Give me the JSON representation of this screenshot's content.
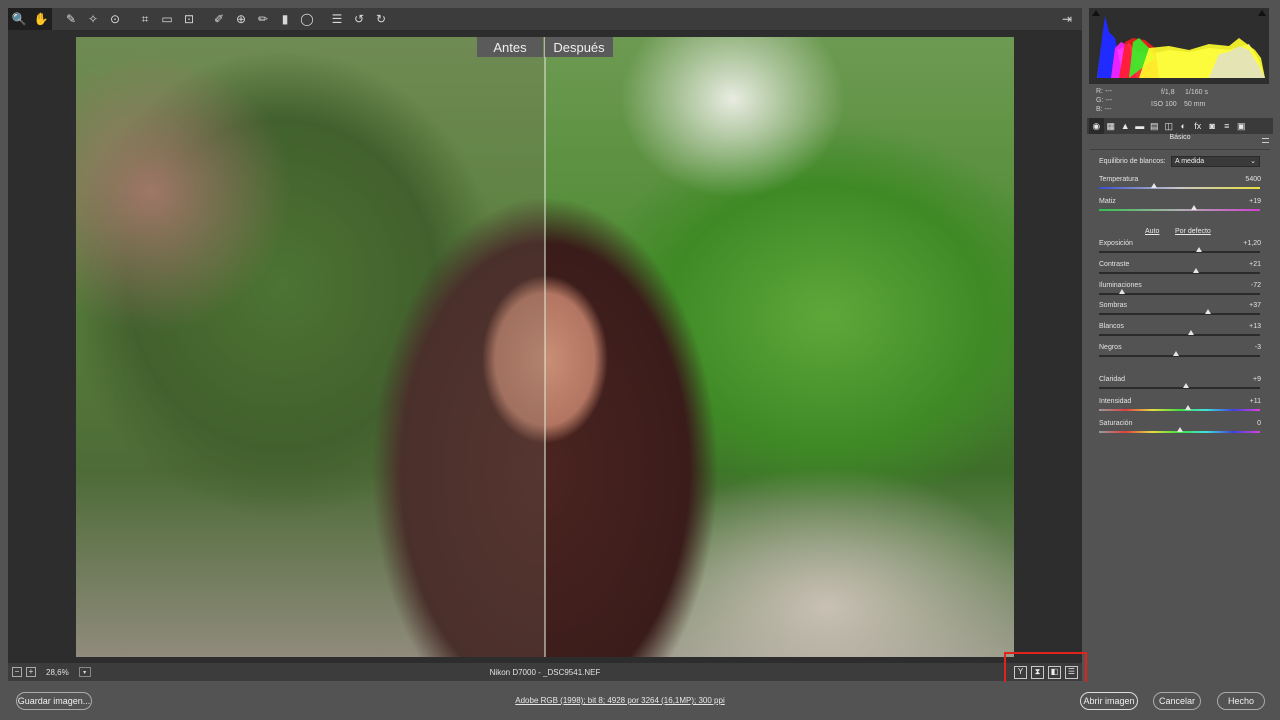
{
  "toolbar": {
    "tools": [
      {
        "name": "zoom-tool",
        "glyph": "🔍"
      },
      {
        "name": "hand-tool",
        "glyph": "✋"
      },
      {
        "name": "white-balance-tool",
        "glyph": "✎"
      },
      {
        "name": "color-sampler-tool",
        "glyph": "✧"
      },
      {
        "name": "targeted-adjustment-tool",
        "glyph": "⊙"
      },
      {
        "name": "crop-tool",
        "glyph": "⌗"
      },
      {
        "name": "straighten-tool",
        "glyph": "▭"
      },
      {
        "name": "transform-tool",
        "glyph": "⊡"
      },
      {
        "name": "spot-removal-tool",
        "glyph": "✐"
      },
      {
        "name": "red-eye-tool",
        "glyph": "⊕"
      },
      {
        "name": "adjustment-brush-tool",
        "glyph": "✏"
      },
      {
        "name": "graduated-filter-tool",
        "glyph": "▮"
      },
      {
        "name": "radial-filter-tool",
        "glyph": "◯"
      },
      {
        "name": "preferences-tool",
        "glyph": "☰"
      },
      {
        "name": "rotate-left-tool",
        "glyph": "↺"
      },
      {
        "name": "rotate-right-tool",
        "glyph": "↻"
      }
    ],
    "fullscreen_glyph": "⇥"
  },
  "preview": {
    "before_label": "Antes",
    "after_label": "Después"
  },
  "statusbar": {
    "zoom_out": "−",
    "zoom_in": "+",
    "zoom_level": "28,6%",
    "filename": "Nikon D7000 -  _DSC9541.NEF",
    "view_buttons": [
      "Y",
      "⧗",
      "◧",
      "☰"
    ]
  },
  "footer": {
    "save_label": "Guardar imagen...",
    "workflow_link": "Adobe RGB (1998); bit 8; 4928 por 3264 (16,1MP); 300 ppi",
    "open_label": "Abrir imagen",
    "cancel_label": "Cancelar",
    "done_label": "Hecho"
  },
  "panel": {
    "readout": {
      "r": "R:   ---",
      "g": "G:   ---",
      "b": "B:   ---",
      "aperture": "f/1,8",
      "shutter": "1/160 s",
      "iso": "ISO 100",
      "focal": "50 mm"
    },
    "tabs": [
      "◉",
      "▦",
      "▲",
      "▬",
      "▤",
      "◫",
      "◐",
      "fx",
      "◙",
      "≡",
      "▣"
    ],
    "title": "Básico",
    "wb_label": "Equilibrio de blancos:",
    "wb_value": "A medida",
    "auto_link": "Auto",
    "default_link": "Por defecto",
    "controls": [
      {
        "id": "temperatura",
        "label": "Temperatura",
        "value": "5400",
        "position": 0.34,
        "track": "temp"
      },
      {
        "id": "matiz",
        "label": "Matiz",
        "value": "+19",
        "position": 0.59,
        "track": "tint"
      },
      {
        "id": "exposicion",
        "label": "Exposición",
        "value": "+1,20",
        "position": 0.62,
        "track": "plain"
      },
      {
        "id": "contraste",
        "label": "Contraste",
        "value": "+21",
        "position": 0.6,
        "track": "plain"
      },
      {
        "id": "iluminaciones",
        "label": "Iluminaciones",
        "value": "-72",
        "position": 0.14,
        "track": "plain"
      },
      {
        "id": "sombras",
        "label": "Sombras",
        "value": "+37",
        "position": 0.68,
        "track": "plain"
      },
      {
        "id": "blancos",
        "label": "Blancos",
        "value": "+13",
        "position": 0.57,
        "track": "plain"
      },
      {
        "id": "negros",
        "label": "Negros",
        "value": "-3",
        "position": 0.48,
        "track": "plain"
      },
      {
        "id": "claridad",
        "label": "Claridad",
        "value": "+9",
        "position": 0.54,
        "track": "plain"
      },
      {
        "id": "intensidad",
        "label": "Intensidad",
        "value": "+11",
        "position": 0.55,
        "track": "vibrance"
      },
      {
        "id": "saturacion",
        "label": "Saturación",
        "value": "0",
        "position": 0.5,
        "track": "saturation"
      }
    ]
  },
  "colors": {
    "highlight_box": "#e0231b",
    "histogram_blue": "#1f2bff",
    "histogram_red": "#ff1a1a",
    "histogram_yellow": "#ffff2a",
    "histogram_green": "#2aff2a",
    "histogram_white": "#dcdcdc"
  }
}
